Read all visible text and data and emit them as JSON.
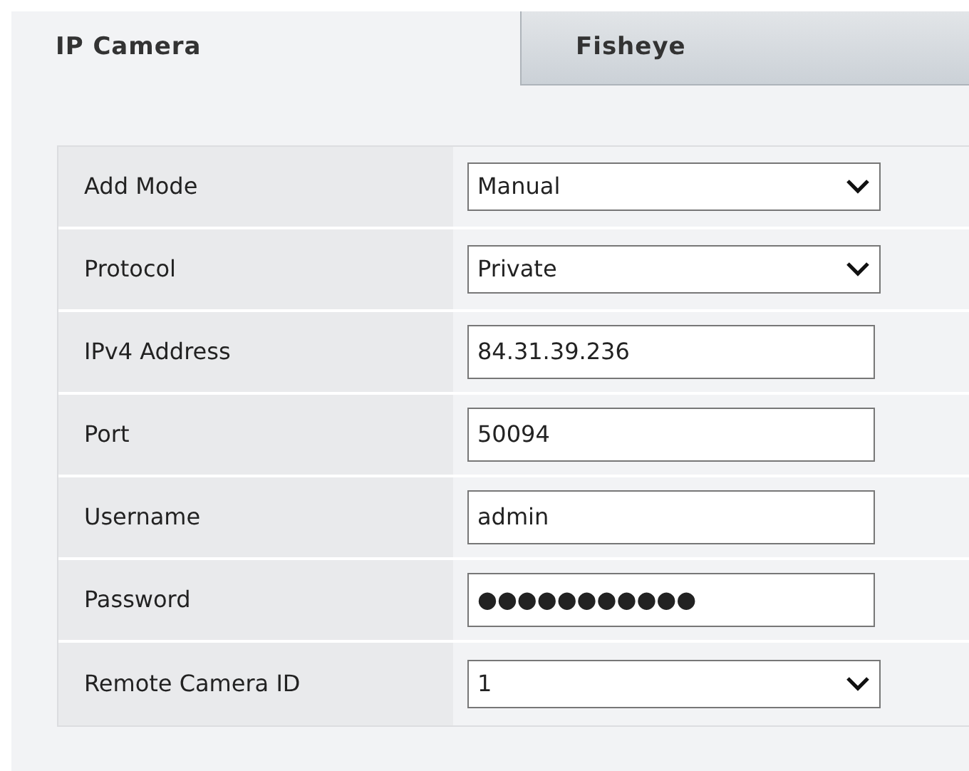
{
  "tabs": [
    {
      "label": "IP Camera",
      "selected": true
    },
    {
      "label": "Fisheye",
      "selected": false
    }
  ],
  "form": {
    "rows": [
      {
        "label": "Add Mode",
        "kind": "select",
        "value": "Manual"
      },
      {
        "label": "Protocol",
        "kind": "select",
        "value": "Private"
      },
      {
        "label": "IPv4 Address",
        "kind": "text",
        "value": "84.31.39.236"
      },
      {
        "label": "Port",
        "kind": "text",
        "value": "50094"
      },
      {
        "label": "Username",
        "kind": "text",
        "value": "admin"
      },
      {
        "label": "Password",
        "kind": "text",
        "value": "●●●●●●●●●●●"
      },
      {
        "label": "Remote Camera ID",
        "kind": "select",
        "value": "1"
      }
    ]
  }
}
